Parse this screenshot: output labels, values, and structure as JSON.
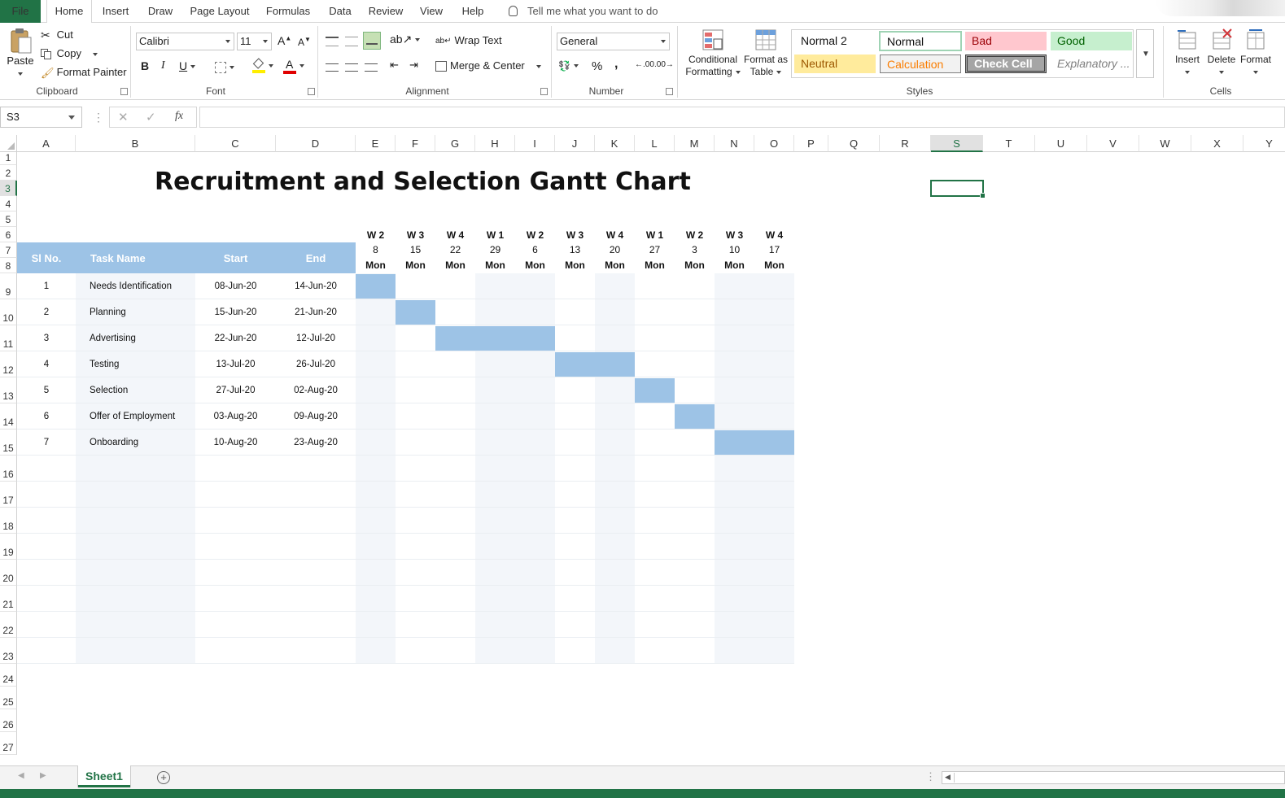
{
  "menu": {
    "tabs": [
      "File",
      "Home",
      "Insert",
      "Draw",
      "Page Layout",
      "Formulas",
      "Data",
      "Review",
      "View",
      "Help"
    ],
    "tell_me": "Tell me what you want to do"
  },
  "ribbon": {
    "clipboard": {
      "paste": "Paste",
      "cut": "Cut",
      "copy": "Copy",
      "format_painter": "Format Painter",
      "label": "Clipboard"
    },
    "font": {
      "name": "Calibri",
      "size": "11",
      "bold": "B",
      "italic": "I",
      "underline": "U",
      "label": "Font"
    },
    "alignment": {
      "wrap_text": "Wrap Text",
      "merge_center": "Merge & Center",
      "label": "Alignment"
    },
    "number": {
      "format": "General",
      "percent": "%",
      "comma": ",",
      "inc_decimal": ".00",
      "dec_decimal": ".00",
      "label": "Number"
    },
    "styles": {
      "conditional_formatting_1": "Conditional",
      "conditional_formatting_2": "Formatting",
      "format_as_table_1": "Format as",
      "format_as_table_2": "Table",
      "normal2": "Normal 2",
      "normal": "Normal",
      "bad": "Bad",
      "good": "Good",
      "neutral": "Neutral",
      "calculation": "Calculation",
      "check_cell": "Check Cell",
      "explanatory": "Explanatory ...",
      "label": "Styles"
    },
    "cells": {
      "insert": "Insert",
      "delete": "Delete",
      "format": "Format",
      "label": "Cells"
    }
  },
  "formula_bar": {
    "name_box": "S3",
    "fx": "fx",
    "value": ""
  },
  "colors": {
    "accent": "#217346",
    "header_fill": "#9dc3e6",
    "bar_fill": "#9dc3e6",
    "shade": "#f3f6fa"
  },
  "grid": {
    "columns": [
      "A",
      "B",
      "C",
      "D",
      "E",
      "F",
      "G",
      "H",
      "I",
      "J",
      "K",
      "L",
      "M",
      "N",
      "O",
      "P",
      "Q",
      "R",
      "S",
      "T",
      "U",
      "V",
      "W",
      "X",
      "Y"
    ],
    "rows": [
      "1",
      "2",
      "3",
      "4",
      "5",
      "6",
      "7",
      "8",
      "9",
      "10",
      "11",
      "12",
      "13",
      "14",
      "15",
      "16",
      "17",
      "18",
      "19",
      "20",
      "21",
      "22",
      "23",
      "24",
      "25",
      "26",
      "27"
    ],
    "selected_col": "S",
    "selected_row": "3"
  },
  "sheet": {
    "title": "Recruitment and Selection Gantt Chart",
    "headers": {
      "sl": "Sl No.",
      "task": "Task Name",
      "start": "Start",
      "end": "End"
    },
    "weeks": [
      {
        "wk": "W 2",
        "day": "8",
        "dow": "Mon"
      },
      {
        "wk": "W 3",
        "day": "15",
        "dow": "Mon"
      },
      {
        "wk": "W 4",
        "day": "22",
        "dow": "Mon"
      },
      {
        "wk": "W 1",
        "day": "29",
        "dow": "Mon"
      },
      {
        "wk": "W 2",
        "day": "6",
        "dow": "Mon"
      },
      {
        "wk": "W 3",
        "day": "13",
        "dow": "Mon"
      },
      {
        "wk": "W 4",
        "day": "20",
        "dow": "Mon"
      },
      {
        "wk": "W 1",
        "day": "27",
        "dow": "Mon"
      },
      {
        "wk": "W 2",
        "day": "3",
        "dow": "Mon"
      },
      {
        "wk": "W 3",
        "day": "10",
        "dow": "Mon"
      },
      {
        "wk": "W 4",
        "day": "17",
        "dow": "Mon"
      }
    ],
    "tasks": [
      {
        "sl": "1",
        "name": "Needs Identification",
        "start": "08-Jun-20",
        "end": "14-Jun-20",
        "from_week": 0,
        "to_week": 0
      },
      {
        "sl": "2",
        "name": "Planning",
        "start": "15-Jun-20",
        "end": "21-Jun-20",
        "from_week": 1,
        "to_week": 1
      },
      {
        "sl": "3",
        "name": "Advertising",
        "start": "22-Jun-20",
        "end": "12-Jul-20",
        "from_week": 2,
        "to_week": 4
      },
      {
        "sl": "4",
        "name": "Testing",
        "start": "13-Jul-20",
        "end": "26-Jul-20",
        "from_week": 5,
        "to_week": 6
      },
      {
        "sl": "5",
        "name": "Selection",
        "start": "27-Jul-20",
        "end": "02-Aug-20",
        "from_week": 7,
        "to_week": 7
      },
      {
        "sl": "6",
        "name": "Offer of Employment",
        "start": "03-Aug-20",
        "end": "09-Aug-20",
        "from_week": 8,
        "to_week": 8
      },
      {
        "sl": "7",
        "name": "Onboarding",
        "start": "10-Aug-20",
        "end": "23-Aug-20",
        "from_week": 9,
        "to_week": 10
      }
    ]
  },
  "sheet_tabs": {
    "active": "Sheet1",
    "add": "+"
  }
}
